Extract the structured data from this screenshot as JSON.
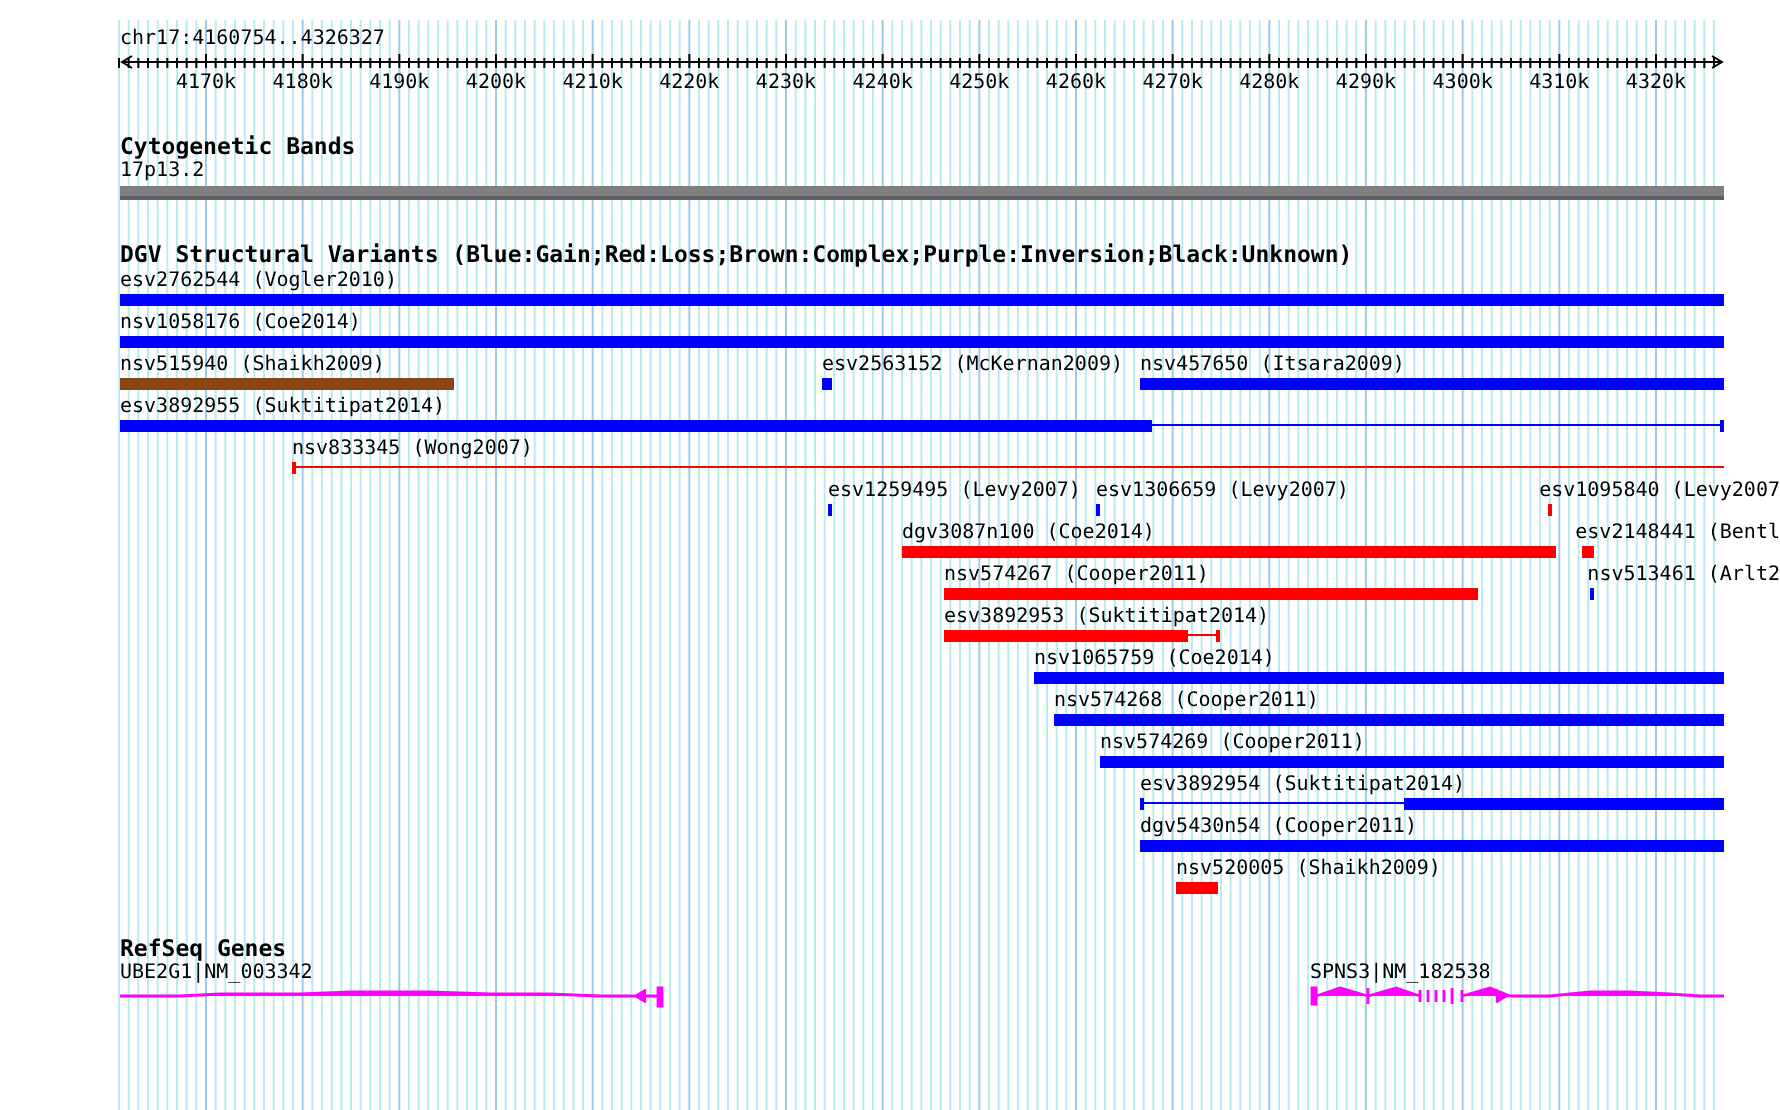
{
  "ruler": {
    "location": "chr17:4160754..4326327",
    "ticks": [
      "4170k",
      "4180k",
      "4190k",
      "4200k",
      "4210k",
      "4220k",
      "4230k",
      "4240k",
      "4250k",
      "4260k",
      "4270k",
      "4280k",
      "4290k",
      "4300k",
      "4310k",
      "4320k"
    ]
  },
  "cytogenetic_bands": {
    "title": "Cytogenetic Bands",
    "band": "17p13.2"
  },
  "dgv_variants": {
    "title": "DGV Structural Variants (Blue:Gain;Red:Loss;Brown:Complex;Purple:Inversion;Black:Unknown)",
    "features": [
      {
        "label": "esv2762544 (Vogler2010)",
        "color": "#0000ff"
      },
      {
        "label": "nsv1058176 (Coe2014)",
        "color": "#0000ff"
      },
      {
        "label": "nsv515940 (Shaikh2009)",
        "color": "#8b4513"
      },
      {
        "label": "esv2563152 (McKernan2009)",
        "color": "#0000ff"
      },
      {
        "label": "nsv457650 (Itsara2009)",
        "color": "#0000ff"
      },
      {
        "label": "esv3892955 (Suktitipat2014)",
        "color": "#0000ff"
      },
      {
        "label": "nsv833345 (Wong2007)",
        "color": "#ff0000"
      },
      {
        "label": "esv1259495 (Levy2007)",
        "color": "#0000ff"
      },
      {
        "label": "esv1306659 (Levy2007)",
        "color": "#0000ff"
      },
      {
        "label": "esv1095840 (Levy2007",
        "color": "#ff0000"
      },
      {
        "label": "dgv3087n100 (Coe2014)",
        "color": "#ff0000"
      },
      {
        "label": "esv2148441 (Bentl",
        "color": "#ff0000"
      },
      {
        "label": "nsv574267 (Cooper2011)",
        "color": "#ff0000"
      },
      {
        "label": "nsv513461 (Arlt2",
        "color": "#0000ff"
      },
      {
        "label": "esv3892953 (Suktitipat2014)",
        "color": "#ff0000"
      },
      {
        "label": "nsv1065759 (Coe2014)",
        "color": "#0000ff"
      },
      {
        "label": "nsv574268 (Cooper2011)",
        "color": "#0000ff"
      },
      {
        "label": "nsv574269 (Cooper2011)",
        "color": "#0000ff"
      },
      {
        "label": "esv3892954 (Suktitipat2014)",
        "color": "#0000ff"
      },
      {
        "label": "dgv5430n54 (Cooper2011)",
        "color": "#0000ff"
      },
      {
        "label": "nsv520005 (Shaikh2009)",
        "color": "#ff0000"
      }
    ]
  },
  "refseq_genes": {
    "title": "RefSeq Genes",
    "genes": [
      {
        "label": "UBE2G1|NM_003342"
      },
      {
        "label": "SPNS3|NM_182538"
      }
    ]
  }
}
